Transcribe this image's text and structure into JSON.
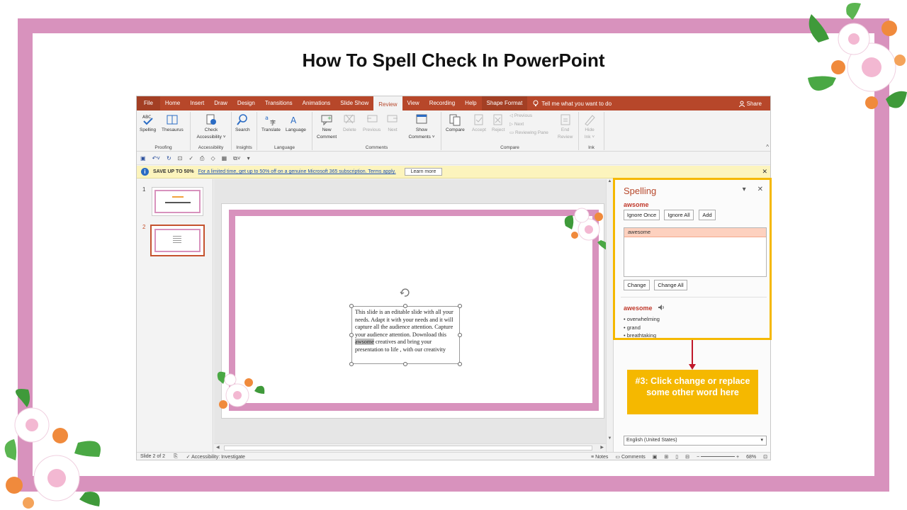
{
  "page": {
    "title": "How To Spell Check In PowerPoint"
  },
  "tabs": [
    "File",
    "Home",
    "Insert",
    "Draw",
    "Design",
    "Transitions",
    "Animations",
    "Slide Show",
    "Review",
    "View",
    "Recording",
    "Help",
    "Shape Format"
  ],
  "active_tab": "Review",
  "tell_me": "Tell me what you want to do",
  "share": "Share",
  "ribbon": {
    "spelling": "Spelling",
    "thesaurus": "Thesaurus",
    "proofing": "Proofing",
    "check_accessibility_1": "Check",
    "check_accessibility_2": "Accessibility ˅",
    "accessibility": "Accessibility",
    "search": "Search",
    "insights": "Insights",
    "translate": "Translate",
    "language_btn": "Language",
    "language": "Language",
    "new_comment_1": "New",
    "new_comment_2": "Comment",
    "delete": "Delete",
    "previous": "Previous",
    "next": "Next",
    "show_comments_1": "Show",
    "show_comments_2": "Comments ˅",
    "comments": "Comments",
    "compare_btn": "Compare",
    "accept": "Accept",
    "reject": "Reject",
    "prev_change": "Previous",
    "next_change": "Next",
    "reviewing_pane": "Reviewing Pane",
    "end_review_1": "End",
    "end_review_2": "Review",
    "compare": "Compare",
    "hide_ink_1": "Hide",
    "hide_ink_2": "Ink ˅",
    "ink": "Ink"
  },
  "message_bar": {
    "bold": "SAVE UP TO 50%",
    "link": "For a limited time, get up to 50% off on a genuine Microsoft 365 subscription. Terms apply.",
    "button": "Learn more"
  },
  "thumbnails": [
    "1",
    "2"
  ],
  "slide_text": {
    "before": "This slide is an editable slide with all your needs. Adapt it with your needs and it will capture all the audience attention. Capture your audience attention. Download this ",
    "misspelled": "awsome",
    "after": " creatives and bring your presentation to life , with our creativity"
  },
  "spelling_pane": {
    "title": "Spelling",
    "misspelled_word": "awsome",
    "ignore_once": "Ignore Once",
    "ignore_all": "Ignore All",
    "add": "Add",
    "suggestion": "awesome",
    "change": "Change",
    "change_all": "Change All",
    "synonym_word": "awesome",
    "synonyms": [
      "• overwhelming",
      "• grand",
      "• breathtaking"
    ],
    "language": "English (United States)"
  },
  "status": {
    "slide": "Slide 2 of 2",
    "accessibility": "Accessibility: Investigate",
    "notes": "Notes",
    "comments": "Comments",
    "zoom": "68%"
  },
  "callout": "#3: Click change or replace some other word here",
  "colors": {
    "frame": "#d892bd",
    "accent": "#b7472a",
    "highlight": "#f5b800",
    "arrow": "#c0182a"
  }
}
